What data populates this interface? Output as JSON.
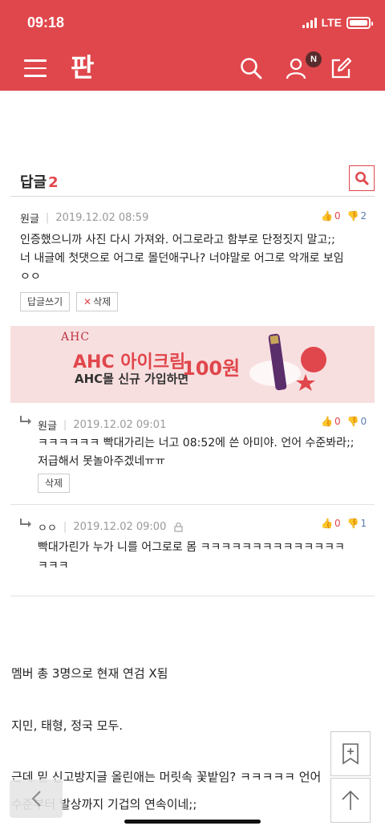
{
  "status": {
    "time": "09:18",
    "network": "LTE"
  },
  "nav": {
    "logo": "판",
    "notif_badge": "N"
  },
  "replies": {
    "label": "답글",
    "count": "2"
  },
  "comment": {
    "author": "원글",
    "date": "2019.12.02 08:59",
    "up": "0",
    "down": "2",
    "lines": [
      "인증했으니까 사진 다시 가져와. 어그로라고 함부로 단정짓지 말고;;",
      "너 내글에 첫댓으로 어그로 몰던애구나? 너야말로 어그로 악개로 보임",
      "ㅇㅇ"
    ],
    "reply_button": "답글쓰기",
    "delete_button": "삭제"
  },
  "ad": {
    "brand": "AHC",
    "headline": "AHC 아이크림",
    "sub": "AHC몰 신규 가입하면",
    "price": "100원"
  },
  "reply1": {
    "author": "원글",
    "date": "2019.12.02 09:01",
    "up": "0",
    "down": "0",
    "lines": [
      "ㅋㅋㅋㅋㅋㅋ 빡대가리는 너고 08:52에 쓴 아미야. 언어 수준봐라;;",
      "저급해서 못놀아주겠네ㅠㅠ"
    ],
    "delete_button": "삭제"
  },
  "reply2": {
    "author": "ㅇㅇ",
    "date": "2019.12.02 09:00",
    "up": "0",
    "down": "1",
    "lines": [
      "빡대가린가 누가 니를 어그로로 몸 ㅋㅋㅋㅋㅋㅋㅋㅋㅋㅋㅋㅋㅋㅋ",
      "ㅋㅋㅋ"
    ]
  },
  "article": {
    "p1": "멤버 총 3명으로 현재 연검 X됨",
    "p2": "지민, 태형, 정국 모두.",
    "p3a": "근데 밑 신고방지글 올린애는 머릿속 꽃밭임? ㅋㅋㅋㅋㅋ 언어",
    "p3b": "수준부터 발상까지 기겁의 연속이네;;"
  },
  "colors": {
    "brand": "#e0474c",
    "down_vote": "#5b7db1"
  }
}
